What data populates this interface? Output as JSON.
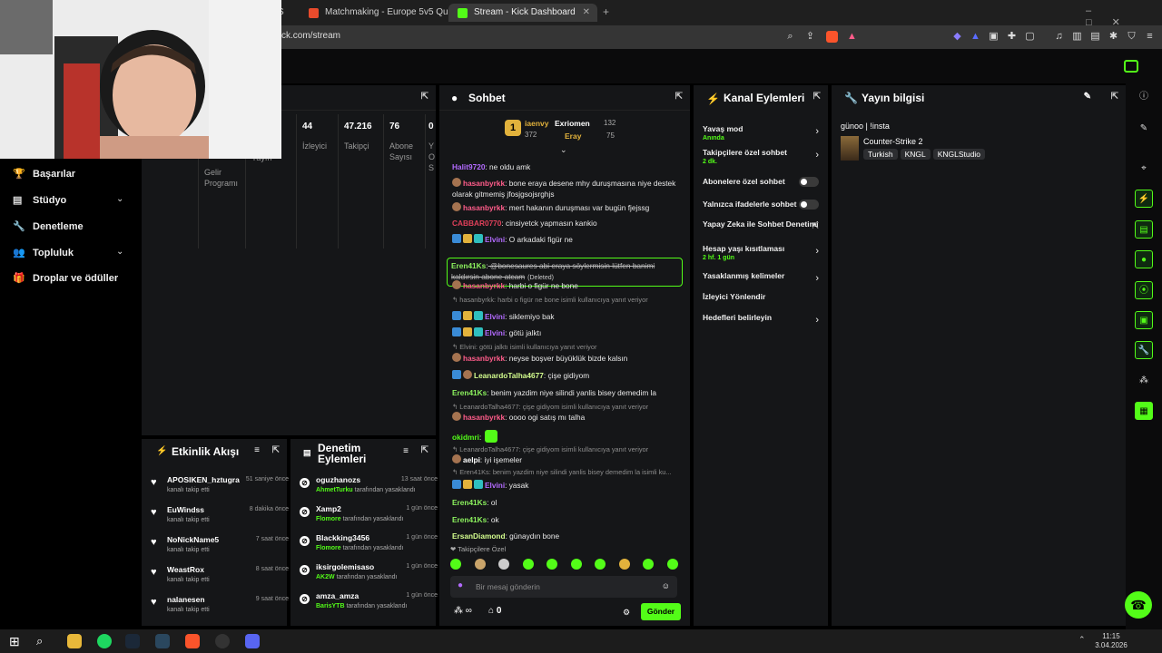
{
  "browser": {
    "tabs": [
      {
        "label": "S"
      },
      {
        "label": "Matchmaking - Europe 5v5 Queue -"
      },
      {
        "label": "Stream - Kick Dashboard",
        "active": true
      }
    ],
    "url": "ck.com/stream",
    "add_tab": "+"
  },
  "sidebar": {
    "items": [
      {
        "label": "Başarılar"
      },
      {
        "label": "Stüdyo"
      },
      {
        "label": "Denetleme"
      },
      {
        "label": "Topluluk"
      },
      {
        "label": "Droplar ve ödüller"
      }
    ]
  },
  "stats": {
    "partial": [
      "Gelir Programı",
      "Yayın"
    ],
    "cols": [
      {
        "value": "44",
        "label": "İzleyici"
      },
      {
        "value": "47.216",
        "label": "Takipçi"
      },
      {
        "value": "76",
        "label": "Abone Sayısı"
      },
      {
        "value": "0",
        "label": "Y O S"
      }
    ]
  },
  "chat": {
    "title": "Sohbet",
    "top": {
      "rank": "1",
      "user1": "iaenvy",
      "user1_count": "372",
      "user2": "Exriomen",
      "user2_count": "132",
      "user3": "Eray",
      "user3_count": "75"
    },
    "messages": [
      {
        "user": "Halit9720",
        "text": " ne oldu amk",
        "color": "purple"
      },
      {
        "user": "hasanbyrkk",
        "text": " bone eraya desene mhy duruşmasına niye destek olarak gitmemiş jfosjgsojsrghjs",
        "color": "pink"
      },
      {
        "user": "hasanbyrkk",
        "text": " mert hakanın duruşması var bugün fjejssg",
        "color": "pink"
      },
      {
        "user": "CABBAR0770",
        "text": " cinsiyetck yapmasın kankio",
        "color": "red"
      },
      {
        "user": "Elvini",
        "text": " O arkadaki figür ne",
        "color": "purple"
      },
      {
        "user": "Eren41Ks",
        "text": " @bonesaures abi eraya söylermisin lütfen banimi kaldırsin abone atcam",
        "deleted": "(Deleted)",
        "color": "lgreen"
      },
      {
        "user": "hasanbyrkk",
        "text": " harbi o figür ne bone",
        "color": "pink"
      },
      {
        "reply": "hasanbyrkk: harbi o figür ne bone isimli kullanıcıya yanıt veriyor"
      },
      {
        "user": "Elvini",
        "text": " siklemiyo bak",
        "color": "purple"
      },
      {
        "user": "Elvini",
        "text": " götü jalktı",
        "color": "purple"
      },
      {
        "reply": "Elvini: götü jalktı isimli kullanıcıya yanıt veriyor"
      },
      {
        "user": "hasanbyrkk",
        "text": " neyse boşver büyüklük bizde kalsın",
        "color": "pink"
      },
      {
        "user": "LeanardoTalha4677",
        "text": " çişe gidiyom",
        "color": "lime"
      },
      {
        "user": "Eren41Ks",
        "text": " benim yazdim niye silindi yanlis bisey demedim la",
        "color": "lgreen"
      },
      {
        "reply": "LeanardoTalha4677: çişe gidiyom isimli kullanıcıya yanıt veriyor"
      },
      {
        "user": "hasanbyrkk",
        "text": " oooo ogi satış mı talha",
        "color": "pink"
      },
      {
        "user": "okidmri",
        "text": "",
        "color": "green"
      },
      {
        "reply": "LeanardoTalha4677: çişe gidiyom isimli kullanıcıya yanıt veriyor"
      },
      {
        "user": "aelpi",
        "text": " iyi işemeler",
        "color": "white"
      },
      {
        "reply": "Eren41Ks: benim yazdim niye silindi yanlis bisey demedim la isimli ku..."
      },
      {
        "user": "Elvini",
        "text": " yasak",
        "color": "purple"
      },
      {
        "user": "Eren41Ks",
        "text": " ol",
        "color": "lgreen"
      },
      {
        "user": "Eren41Ks",
        "text": " ok",
        "color": "lgreen"
      },
      {
        "user": "ErsanDiamond",
        "text": " günaydın bone",
        "color": "lime"
      }
    ],
    "followers_only": "Takipçilere Özel",
    "input_placeholder": "Bir mesaj gönderin",
    "infinity": "∞",
    "count": "0",
    "send": "Gönder"
  },
  "channel_actions": {
    "title": "Kanal Eylemleri",
    "items": [
      {
        "label": "Yavaş mod",
        "sub": "Anında",
        "kind": "chev"
      },
      {
        "label": "Takipçilere özel sohbet",
        "sub": "2 dk.",
        "kind": "chev"
      },
      {
        "label": "Abonelere özel sohbet",
        "sub": "",
        "kind": "toggle"
      },
      {
        "label": "Yalnızca ifadelerle sohbet",
        "sub": "",
        "kind": "toggle"
      },
      {
        "label": "Yapay Zeka ile Sohbet Denetimi",
        "sub": "",
        "kind": "ext"
      },
      {
        "label": "Hesap yaşı kısıtlaması",
        "sub": "2 hf. 1 gün",
        "kind": "chev"
      },
      {
        "label": "Yasaklanmış kelimeler",
        "sub": "",
        "kind": "chev"
      },
      {
        "label": "İzleyici Yönlendir",
        "sub": "",
        "kind": "none"
      },
      {
        "label": "Hedefleri belirleyin",
        "sub": "",
        "kind": "chev"
      }
    ]
  },
  "stream_info": {
    "title": "Yayın bilgisi",
    "stream_title": "günoo | !insta",
    "category": "Counter-Strike 2",
    "tags": [
      "Turkish",
      "KNGL",
      "KNGLStudio"
    ]
  },
  "activity": {
    "title": "Etkinlik Akışı",
    "items": [
      {
        "name": "APOSIKEN_hztugra",
        "sub": "kanalı takip etti",
        "time": "51 saniye önce"
      },
      {
        "name": "EuWindss",
        "sub": "kanalı takip etti",
        "time": "8 dakika önce"
      },
      {
        "name": "NoNickName5",
        "sub": "kanalı takip etti",
        "time": "7 saat önce"
      },
      {
        "name": "WeastRox",
        "sub": "kanalı takip etti",
        "time": "8 saat önce"
      },
      {
        "name": "nalanesen",
        "sub": "kanalı takip etti",
        "time": "9 saat önce"
      }
    ]
  },
  "moderation": {
    "title": "Denetim Eylemleri",
    "suffix": "tarafından yasaklandı",
    "items": [
      {
        "name": "oguzhanozs",
        "by": "AhmetTurku",
        "time": "13 saat önce"
      },
      {
        "name": "Xamp2",
        "by": "Flomore",
        "time": "1 gün önce"
      },
      {
        "name": "Blackking3456",
        "by": "Flomore",
        "time": "1 gün önce"
      },
      {
        "name": "iksirgolemisaso",
        "by": "AK2W",
        "time": "1 gün önce"
      },
      {
        "name": "amza_amza",
        "by": "BarisYTB",
        "time": "1 gün önce"
      }
    ]
  },
  "taskbar": {
    "time": "11:15",
    "date": "3.04.2026"
  },
  "colors": {
    "kick_green": "#53fc18",
    "panel": "#151618",
    "background": "#000000"
  }
}
